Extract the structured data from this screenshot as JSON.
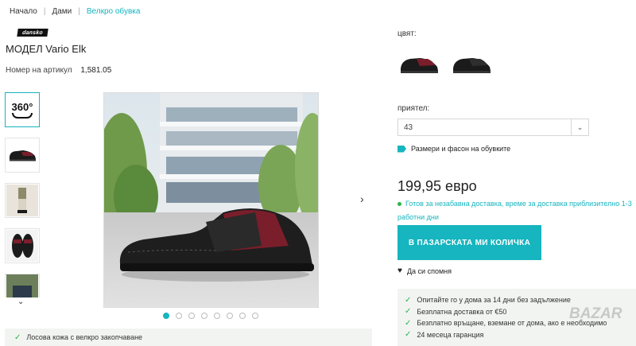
{
  "breadcrumb": {
    "items": [
      "Начало",
      "Дами",
      "Велкро обувка"
    ]
  },
  "brand": {
    "logo_text": "dansko"
  },
  "product": {
    "title": "МОДЕЛ Vario Elk",
    "sku_label": "Номер на артикул",
    "sku_value": "1,581.05",
    "price": "199,95 евро",
    "stock_text": "Готов за незабавна доставка, време за доставка приблизително 1-3 работни дни"
  },
  "gallery": {
    "thumb_360_label": "360°",
    "dots_count": 8,
    "active_dot": 0
  },
  "features": {
    "first": "Лосова кожа с велкро закопчаване"
  },
  "options": {
    "color_label": "цвят:",
    "size_label": "приятел:",
    "size_value": "43",
    "size_guide": "Размери и фасон на обувките"
  },
  "actions": {
    "cart_button": "В ПАЗАРСКАТА МИ КОЛИЧКА",
    "wishlist": "Да си спомня"
  },
  "benefits": [
    "Опитайте го у дома за 14 дни без задължение",
    "Безплатна доставка от €50",
    "Безплатно връщане, вземане от дома, ако е необходимо",
    "24 месеца гаранция"
  ],
  "watermark": {
    "text": "BAZAR"
  },
  "colors": {
    "accent": "#16b5bf",
    "check": "#2db34a",
    "panel_bg": "#f2f4f2"
  }
}
